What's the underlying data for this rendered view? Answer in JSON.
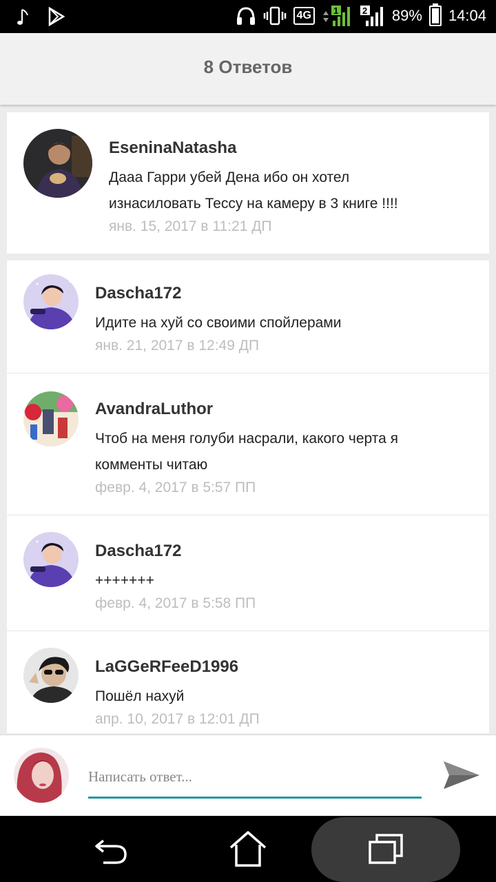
{
  "status_bar": {
    "network": "4G",
    "sim1": "1",
    "sim2": "2",
    "battery": "89%",
    "time": "14:04"
  },
  "header": {
    "title": "8 Ответов"
  },
  "comments": [
    {
      "author": "EseninaNatasha",
      "text_lines": [
        "Дааа Гарри убей Дена ибо он хотел",
        "изнасиловать Тессу на камеру в 3 книге !!!!"
      ],
      "time": "янв. 15, 2017 в 11:21 ДП"
    },
    {
      "author": "Dascha172",
      "text_lines": [
        "Идите на хуй со своими спойлерами"
      ],
      "time": "янв. 21, 2017 в 12:49 ДП"
    },
    {
      "author": "AvandraLuthor",
      "text_lines": [
        "Чтоб на меня голуби насрали, какого черта я",
        "комменты читаю"
      ],
      "time": "февр. 4, 2017 в 5:57 ПП"
    },
    {
      "author": "Dascha172",
      "text_lines": [
        "+++++++"
      ],
      "time": "февр. 4, 2017 в 5:58 ПП"
    },
    {
      "author": "LaGGeRFeeD1996",
      "text_lines": [
        "Пошёл нахуй"
      ],
      "time": "апр. 10, 2017 в 12:01 ДП"
    }
  ],
  "composer": {
    "placeholder": "Написать ответ..."
  },
  "icons": {
    "status_left": [
      "music-note-icon",
      "play-store-icon"
    ],
    "status_right": [
      "headphones-icon",
      "vibrate-icon",
      "signal-icon",
      "battery-icon"
    ],
    "send": "send-icon",
    "nav": [
      "back-icon",
      "home-icon",
      "recent-apps-icon"
    ]
  },
  "colors": {
    "accent": "#1f9aa0",
    "timestamp": "#bdbdbd",
    "header_bg": "#f1f1f1"
  }
}
